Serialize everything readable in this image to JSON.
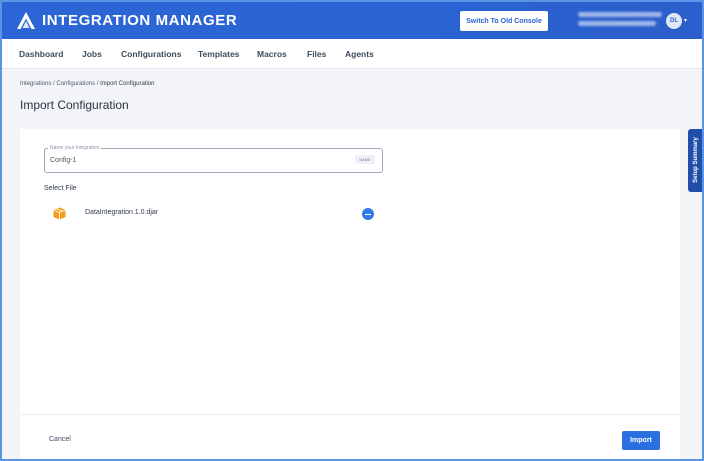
{
  "app": {
    "title": "INTEGRATION MANAGER",
    "logo_icon": "integration-logo-icon",
    "brand_color": "#2a63d2"
  },
  "header": {
    "switch_console_label": "Switch To Old Console",
    "avatar_initials": "DL",
    "avatar_caret_icon": "chevron-down-icon"
  },
  "nav": {
    "items": [
      {
        "label": "Dashboard"
      },
      {
        "label": "Jobs"
      },
      {
        "label": "Configurations"
      },
      {
        "label": "Templates"
      },
      {
        "label": "Macros"
      },
      {
        "label": "Files"
      },
      {
        "label": "Agents"
      }
    ]
  },
  "breadcrumb": {
    "items": [
      "Integrations",
      "Configurations",
      "Import Configuration"
    ],
    "separator": "/"
  },
  "page": {
    "title": "Import Configuration"
  },
  "form": {
    "name_field": {
      "legend": "Name your Integration",
      "value": "Config-1",
      "tag": "NAME"
    },
    "select_file_label": "Select File",
    "file": {
      "name": "DataIntegration.1.0.djar",
      "icon": "package-icon",
      "remove_icon": "minus-circle-icon"
    }
  },
  "footer": {
    "cancel_label": "Cancel",
    "import_label": "Import"
  },
  "side_panel": {
    "label": "Setup Summary"
  }
}
